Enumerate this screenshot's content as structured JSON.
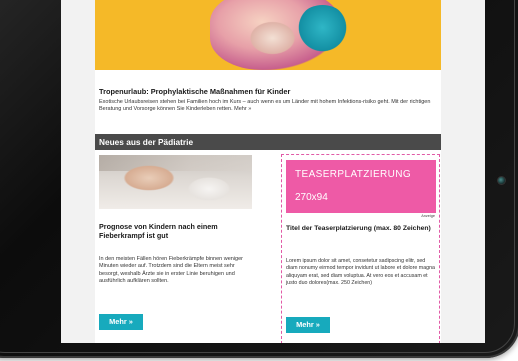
{
  "article": {
    "title": "Tropenurlaub: Prophylaktische Maßnahmen für Kinder",
    "text": "Exotische Urlaubsreisen stehen bei Familien hoch im Kurs – auch wenn es um Länder mit hohem Infektions-risiko geht. Mit der richtigen Beratung und Vorsorge können Sie Kinderleben retten. Mehr »"
  },
  "section": {
    "title": "Neues aus der Pädiatrie"
  },
  "card_left": {
    "title": "Prognose von Kindern nach einem Fieberkrampf ist gut",
    "text": "In den meisten Fällen hören Fieberkrämpfe binnen weniger Minuten wieder auf. Trotzdem sind die Eltern meist sehr besorgt, weshalb Ärzte sie in erster Linie beruhigen und ausführlich aufklären sollten.",
    "button_label": "Mehr »"
  },
  "card_right": {
    "teaser_line1": "TEASERPLATZIERUNG",
    "teaser_line2": "270x94",
    "ad_label": "Anzeige",
    "title": "Titel der Teaserplatzierung (max. 80 Zeichen)",
    "text": "Lorem ipsum dolor sit amet, consetetur sadipscing elitr, sed diam nonumy eirmod tempor invidunt ut labore et dolore magna aliquyam erat, sed diam voluptua. At vero eos et accusam et justo duo dolores(max. 250 Zeichen)",
    "button_label": "Mehr »"
  },
  "colors": {
    "accent": "#17aabd",
    "teaser_bg": "#ee5aa6",
    "section_bar": "#4a4a4a",
    "hero_bg": "#f5b928"
  }
}
